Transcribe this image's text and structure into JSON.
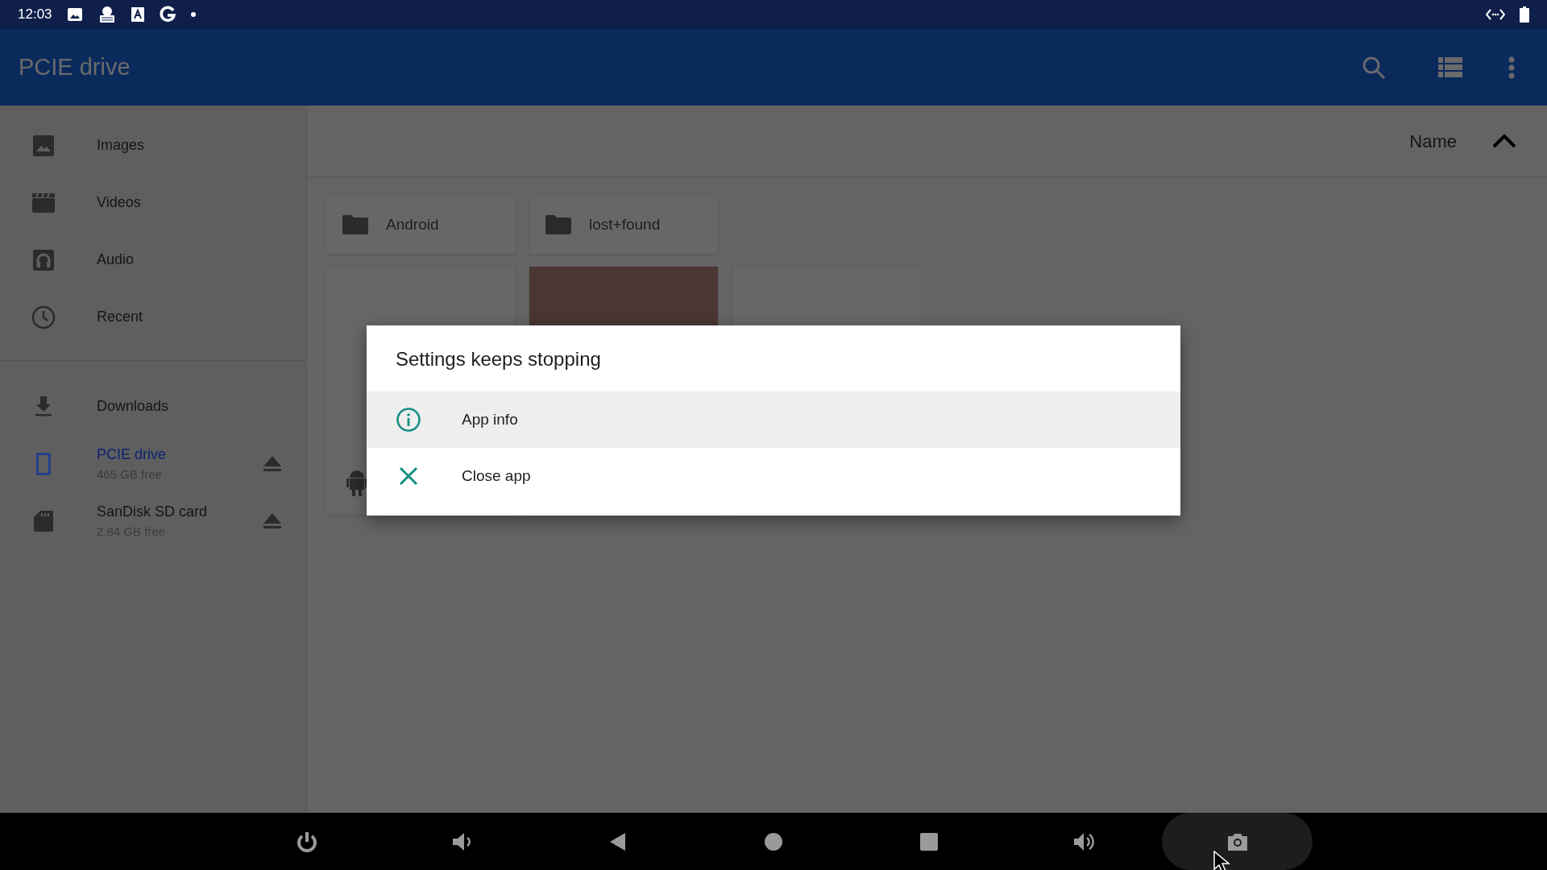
{
  "status_bar": {
    "time": "12:03"
  },
  "app_bar": {
    "title": "PCIE drive"
  },
  "sidebar": {
    "items": [
      {
        "label": "Images",
        "kind": "category",
        "selected": false
      },
      {
        "label": "Videos",
        "kind": "category",
        "selected": false
      },
      {
        "label": "Audio",
        "kind": "category",
        "selected": false
      },
      {
        "label": "Recent",
        "kind": "category",
        "selected": false
      },
      {
        "label": "Downloads",
        "kind": "category",
        "selected": false
      },
      {
        "label": "PCIE drive",
        "subtitle": "465 GB free",
        "kind": "storage",
        "selected": true
      },
      {
        "label": "SanDisk SD card",
        "subtitle": "2.84 GB free",
        "kind": "storage",
        "selected": false
      }
    ]
  },
  "sort": {
    "label": "Name"
  },
  "folders": [
    {
      "name": "Android"
    },
    {
      "name": "lost+found"
    }
  ],
  "thumbnails": [
    {
      "kind": "apk"
    },
    {
      "kind": "photo"
    },
    {
      "kind": "blank"
    }
  ],
  "dialog": {
    "title": "Settings keeps stopping",
    "actions": [
      {
        "label": "App info",
        "kind": "info",
        "selected": true
      },
      {
        "label": "Close app",
        "kind": "close",
        "selected": false
      }
    ]
  }
}
